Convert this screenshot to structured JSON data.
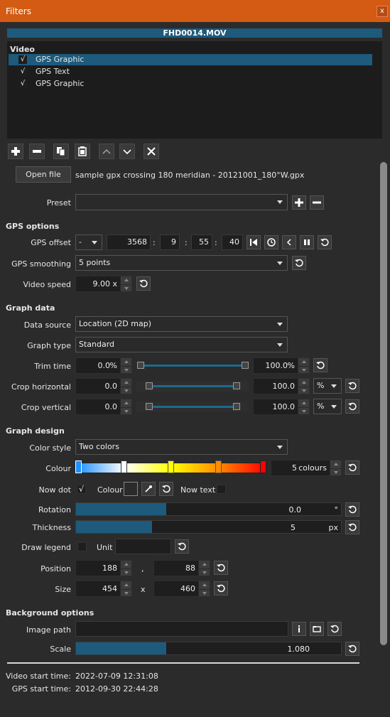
{
  "window": {
    "title": "Filters",
    "close": "x"
  },
  "clip": {
    "name": "FHD0014.MOV"
  },
  "filter_list": {
    "header": "Video",
    "items": [
      {
        "label": "GPS Graphic",
        "checked": "√",
        "selected": true
      },
      {
        "label": "GPS Text",
        "checked": "√"
      },
      {
        "label": "GPS Graphic",
        "checked": "√"
      }
    ]
  },
  "toolbar": {
    "add": "+",
    "remove": "−",
    "copy": "copy",
    "paste": "paste",
    "up": "up",
    "down": "down",
    "close": "×"
  },
  "file": {
    "open_label": "Open file",
    "path": "sample gpx crossing 180 meridian - 20121001_180°W.gpx"
  },
  "preset": {
    "label": "Preset",
    "value": ""
  },
  "gps_options": {
    "title": "GPS options",
    "offset_label": "GPS offset",
    "offset_sign": "-",
    "offset_days": "3568",
    "offset_hours": "9",
    "offset_minutes": "55",
    "offset_seconds": "40",
    "sep": ":",
    "smoothing_label": "GPS smoothing",
    "smoothing_value": "5 points",
    "speed_label": "Video speed",
    "speed_value": "9.00",
    "speed_unit": "x"
  },
  "graph_data": {
    "title": "Graph data",
    "source_label": "Data source",
    "source_value": "Location (2D map)",
    "type_label": "Graph type",
    "type_value": "Standard",
    "trim_label": "Trim time",
    "trim_start": "0.0",
    "trim_end": "100.0",
    "pct": "%",
    "croph_label": "Crop horizontal",
    "croph_start": "0.0",
    "croph_end": "100.0",
    "croph_unit": "%",
    "cropv_label": "Crop vertical",
    "cropv_start": "0.0",
    "cropv_end": "100.0",
    "cropv_unit": "%"
  },
  "graph_design": {
    "title": "Graph design",
    "color_style_label": "Color style",
    "color_style_value": "Two colors",
    "colour_label": "Colour",
    "colours_count": "5",
    "colours_unit": "colours",
    "gradient_colors": [
      "#1e8fff",
      "#ffffff",
      "#ffff00",
      "#ff8c00",
      "#ff0000"
    ],
    "now_dot_label": "Now dot",
    "now_dot_checked": "√",
    "colour_small_label": "Colour",
    "now_text_label": "Now text",
    "rotation_label": "Rotation",
    "rotation_value": "0.0",
    "rotation_unit": "°",
    "rotation_fraction": 0.0,
    "thickness_label": "Thickness",
    "thickness_value": "5",
    "thickness_unit": "px",
    "thickness_fraction": 0.05,
    "legend_label": "Draw legend",
    "unit_label": "Unit",
    "unit_value": "",
    "position_label": "Position",
    "position_x": "188",
    "position_sep": ",",
    "position_y": "88",
    "size_label": "Size",
    "size_w": "454",
    "size_sep": "x",
    "size_h": "460"
  },
  "background": {
    "title": "Background options",
    "image_path_label": "Image path",
    "image_path_value": "",
    "scale_label": "Scale",
    "scale_value": "1.080",
    "scale_fraction": 0.108
  },
  "footer": {
    "video_start_label": "Video start time:",
    "video_start_value": "2022-07-09 12:31:08",
    "gps_start_label": "GPS start time:",
    "gps_start_value": "2012-09-30 22:44:28"
  },
  "accent": "#1d5a7c"
}
